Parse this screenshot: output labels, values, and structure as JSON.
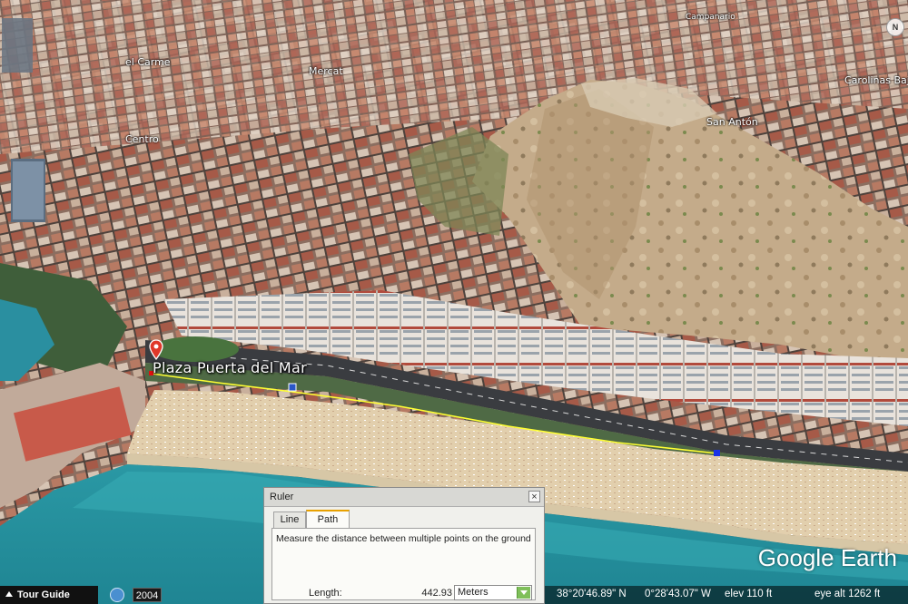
{
  "places": {
    "plaza": "Plaza Puerta del Mar",
    "san_anton": "San Antón",
    "centro": "Centro",
    "mercat": "Mercat",
    "el_carme": "el Carme",
    "carolinas": "Carolinas Baja",
    "campanario": "Campanario"
  },
  "logo": "Google Earth",
  "compass": "N",
  "tour_guide": "Tour Guide",
  "history_year": "2004",
  "status": {
    "lat": "38°20'46.89\" N",
    "lon": "0°28'43.07\" W",
    "elev": "elev  110 ft",
    "eye_alt": "eye alt  1262 ft"
  },
  "ruler": {
    "title": "Ruler",
    "close": "×",
    "tabs": [
      "Line",
      "Path"
    ],
    "active_tab": "Path",
    "description": "Measure the distance between multiple points on the ground",
    "length_label": "Length:",
    "length_value": "442.93",
    "unit": "Meters"
  },
  "colors": {
    "path_line": "#ffff33",
    "active_tab_accent": "#e8a100",
    "sea": "#2aa3b0",
    "beach": "#e6d3b0"
  }
}
